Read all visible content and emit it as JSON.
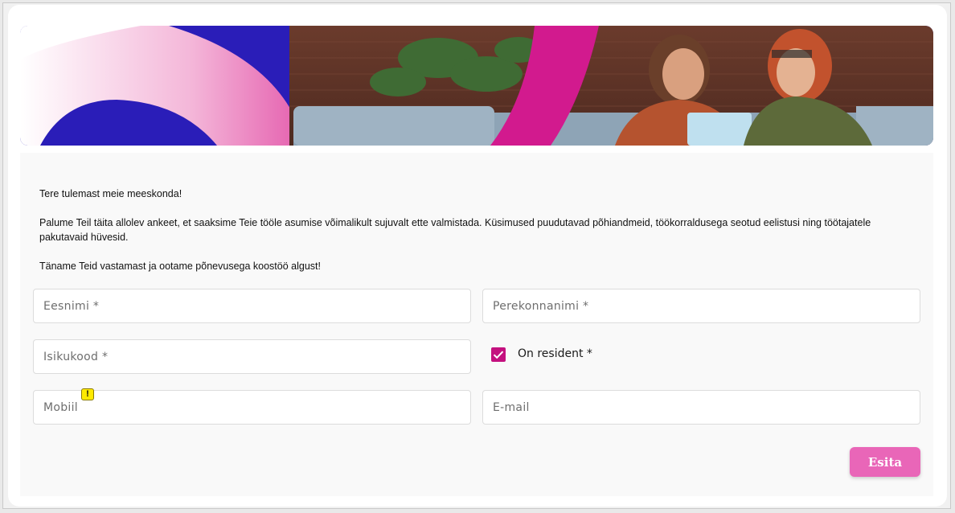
{
  "intro": {
    "greeting": "Tere tulemast meie meeskonda!",
    "paragraph": "Palume Teil täita allolev ankeet, et saaksime Teie tööle asumise võimalikult sujuvalt ette valmistada. Küsimused puudutavad põhiandmeid, töökorraldusega seotud eelistusi ning töötajatele pakutavaid hüvesid.",
    "thanks": "Täname Teid vastamast ja ootame põnevusega koostöö algust!"
  },
  "form": {
    "first_name": {
      "placeholder": "Eesnimi *",
      "value": ""
    },
    "last_name": {
      "placeholder": "Perekonnanimi *",
      "value": ""
    },
    "personal_code": {
      "placeholder": "Isikukood *",
      "value": ""
    },
    "resident": {
      "label": "On resident *",
      "checked": true
    },
    "mobile": {
      "placeholder": "Mobiil",
      "value": ""
    },
    "email": {
      "placeholder": "E-mail",
      "value": ""
    },
    "warning_glyph": "!",
    "submit_label": "Esita"
  },
  "colors": {
    "accent": "#c4117f",
    "button": "#e966b8",
    "banner_blue": "#2a1db8"
  }
}
